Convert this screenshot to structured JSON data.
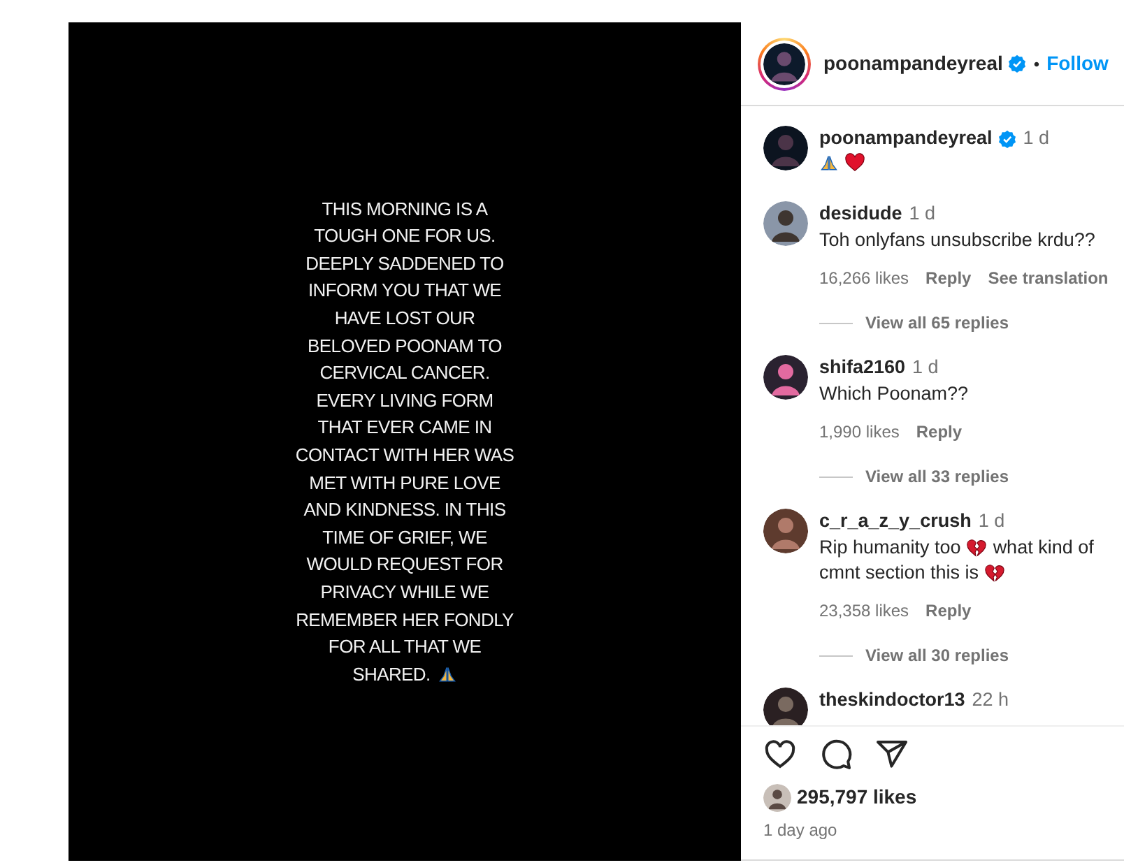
{
  "post_image": {
    "lines": [
      "THIS MORNING IS A",
      "TOUGH ONE FOR US.",
      "DEEPLY SADDENED TO",
      "INFORM YOU THAT WE",
      "HAVE LOST OUR",
      "BELOVED POONAM TO",
      "CERVICAL CANCER.",
      "EVERY LIVING FORM",
      "THAT EVER CAME IN",
      "CONTACT WITH HER WAS",
      "MET WITH PURE LOVE",
      "AND KINDNESS. IN THIS",
      "TIME OF GRIEF, WE",
      "WOULD REQUEST FOR",
      "PRIVACY WHILE WE",
      "REMEMBER HER FONDLY",
      "FOR ALL THAT WE",
      "SHARED."
    ],
    "praying_hands_after": true
  },
  "header": {
    "username": "poonampandeyreal",
    "verified": true,
    "separator": "•",
    "follow": "Follow"
  },
  "caption": {
    "username": "poonampandeyreal",
    "verified": true,
    "time": "1 d",
    "parts": [
      {
        "kind": "pray"
      },
      {
        "kind": "heart"
      }
    ]
  },
  "comments": [
    {
      "username": "desidude",
      "time": "1 d",
      "parts": [
        {
          "kind": "text",
          "text": "Toh onlyfans unsubscribe krdu??"
        }
      ],
      "likes": "16,266 likes",
      "reply": "Reply",
      "translation": "See translation",
      "view_replies": "View all 65 replies"
    },
    {
      "username": "shifa2160",
      "time": "1 d",
      "parts": [
        {
          "kind": "text",
          "text": "Which Poonam??"
        }
      ],
      "likes": "1,990 likes",
      "reply": "Reply",
      "view_replies": "View all 33 replies"
    },
    {
      "username": "c_r_a_z_y_crush",
      "time": "1 d",
      "parts": [
        {
          "kind": "text",
          "text": "Rip humanity too"
        },
        {
          "kind": "broken-heart"
        },
        {
          "kind": "text",
          "text": "what kind of"
        },
        {
          "kind": "text",
          "text": "cmnt section this is"
        },
        {
          "kind": "broken-heart"
        }
      ],
      "likes": "23,358 likes",
      "reply": "Reply",
      "view_replies": "View all 30 replies"
    },
    {
      "username": "theskindoctor13",
      "time": "22 h"
    }
  ],
  "likes": "295,797 likes",
  "posted": "1 day ago"
}
